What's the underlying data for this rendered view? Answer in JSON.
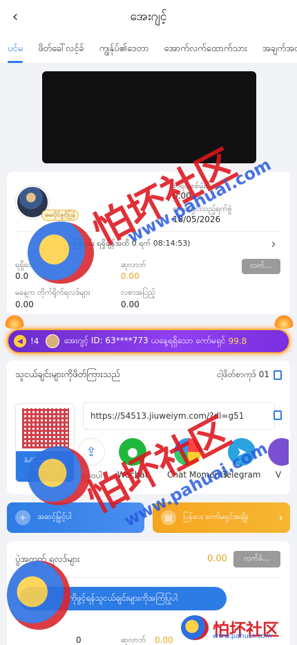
{
  "header": {
    "title": "အေးဂျင့်"
  },
  "tabs": [
    "ပင်မ",
    "ဖိတ်ခေါ်လင့်ခ်",
    "ကျွန်ုပ်၏ဒေတာ",
    "အောက်လက်ထောက်သား",
    "အချက်အလက်"
  ],
  "agent": {
    "vip_badge": "မေးပိုင်ခွင့်ပြန်",
    "account_type_label": "စာရင်းစစ်မှုံးစိ",
    "account_type_value": "0.00",
    "date_label": "စာရင်းရှင်းသည့်ရက်စွဲ",
    "date_value": "18/05/2026",
    "countdown_text": "ကြိုးပမ်း ရရှိချိန်အထိ 0 ရက် 08:14:53)",
    "stat1_label": "ရရှိသော",
    "stat1_value": "0.0",
    "stat2_label": "ဆုလာဘ်",
    "stat2_value": "0.00",
    "stat3_label": "မနေ့က တိုက်ရိုက်ရလဒ်များ",
    "stat3_value": "0.00",
    "stat4_label": "လစာအပြည့်",
    "stat4_value": "0.00",
    "claim_button": "လက်..."
  },
  "ticker": {
    "prefix": "!4",
    "text": "အေးဂျင့် ID: 63****773 ယနေ့ရရှိသော ကော်မရှင်",
    "amount": "99.8"
  },
  "invite": {
    "title": "သူငယ်ချင်းများကိုဖိတ်ကြားသည်",
    "code_label": "ငါ့ဖိတ်စာကုဒ်",
    "code_value": "01",
    "qr_caption": "ဖိတ်ကြားချက်ကုဒ်ကို သိမ်းဆည်းပါ",
    "link": "https://54513.jiuweiym.com/?dl=g51",
    "share": [
      {
        "label": "မျှဝေပါ",
        "icon": "share-icon",
        "color": "#2d7be5"
      },
      {
        "label": "Wechat",
        "icon": "wechat-icon",
        "color": "#20b83a"
      },
      {
        "label": "Chat Moments",
        "icon": "moments-icon",
        "color": "#f2f2f2"
      },
      {
        "label": "Telegram",
        "icon": "telegram-icon",
        "color": "#2aa3e0"
      },
      {
        "label": "V",
        "icon": "viber-icon",
        "color": "#7b4fd1"
      }
    ]
  },
  "actions": {
    "left": "အဆင့်မြှင့်ပါ",
    "right": "ပြန်ပေး ကော်မရှင်အချိုး"
  },
  "team": {
    "title": "ပွဲအတွက် ရလဒ်များ",
    "value": "0.00",
    "claim_button": "လက်ခံ...",
    "invite_button": "ကိုဖွင့်ရန်သူငယ်ချင်းများကိုအကြံပြုပါ",
    "bottom_count": "0",
    "bottom_label": "ဆုလာဘ်",
    "bottom_value": "0.00"
  },
  "watermark": {
    "brand": "怕坏社区",
    "url": "www.pahuai.com",
    "site_small": "www.pahuai.com"
  },
  "colors": {
    "accent": "#2d7be5",
    "gold": "#e2a820",
    "watermark_red": "#d8262f"
  }
}
